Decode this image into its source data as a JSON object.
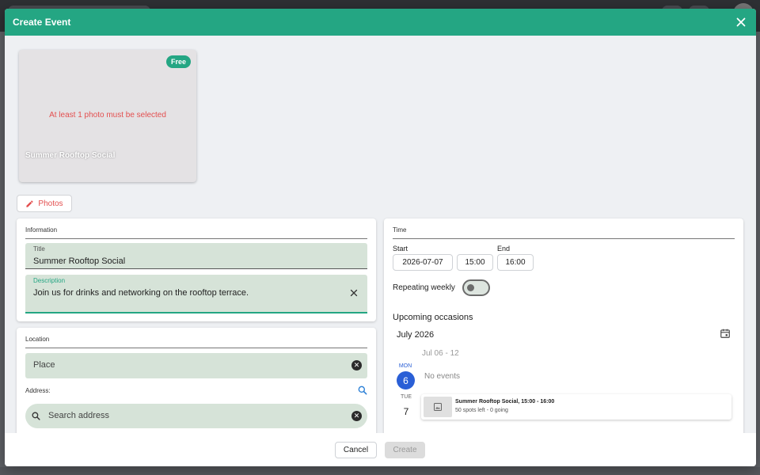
{
  "dialog": {
    "title": "Create Event"
  },
  "photo_card": {
    "badge": "Free",
    "warning": "At least 1 photo must be selected",
    "event_name": "Summer Rooftop Social"
  },
  "photos_button": {
    "label": "Photos"
  },
  "information": {
    "section_title": "Information",
    "title_label": "Title",
    "title_value": "Summer Rooftop Social",
    "description_label": "Description",
    "description_value": "Join us for drinks and networking on the rooftop terrace."
  },
  "location": {
    "section_title": "Location",
    "place_placeholder": "Place",
    "address_label": "Address:",
    "search_placeholder": "Search address"
  },
  "time": {
    "section_title": "Time",
    "start_label": "Start",
    "start_date": "2026-07-07",
    "start_time": "15:00",
    "end_label": "End",
    "end_time": "16:00",
    "repeating_label": "Repeating weekly",
    "repeating_enabled": false
  },
  "upcoming": {
    "heading": "Upcoming occasions",
    "month": "July 2026",
    "week_range": "Jul 06 - 12",
    "days": [
      {
        "name": "MON",
        "number": "6",
        "empty_text": "No events"
      },
      {
        "name": "TUE",
        "number": "7"
      }
    ],
    "event": {
      "title": "Summer Rooftop Social, 15:00 - 16:00",
      "subtitle": "50 spots left - 0 going"
    }
  },
  "footer": {
    "cancel_label": "Cancel",
    "create_label": "Create"
  },
  "colors": {
    "header": "#24a683",
    "accent_red": "#e34f4f",
    "today": "#2a5fd6",
    "field_bg": "#d6e3d8"
  }
}
